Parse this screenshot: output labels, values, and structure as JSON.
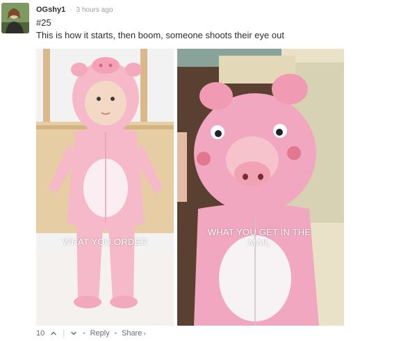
{
  "comment": {
    "author": "OGshy1",
    "separator": "·",
    "timestamp": "3 hours ago",
    "lines": [
      "#25",
      "This is how it starts, then boom, someone shoots their eye out"
    ]
  },
  "image": {
    "left_caption": "WHAT YOU ORDER",
    "right_caption_line1": "WHAT YOU GET IN THE",
    "right_caption_line2": "MAIL"
  },
  "actions": {
    "vote_count": "10",
    "upvote_icon": "chevron-up-icon",
    "divider": "|",
    "downvote_icon": "chevron-down-icon",
    "dot": "•",
    "reply_label": "Reply",
    "share_label": "Share",
    "share_chevron": "›"
  },
  "colors": {
    "author_text": "#2a2e2e",
    "meta_text": "#9aa0a6",
    "action_text": "#656c7a",
    "costume_pink": "#f4b6c8"
  }
}
